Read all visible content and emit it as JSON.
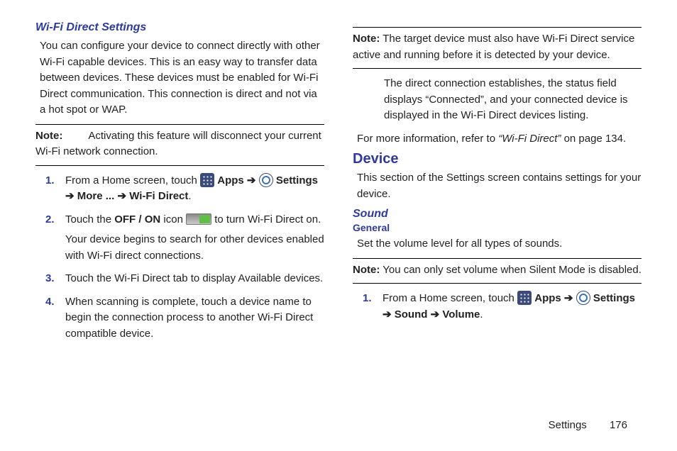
{
  "left": {
    "heading": "Wi-Fi Direct Settings",
    "intro": "You can configure your device to connect directly with other Wi-Fi capable devices. This is an easy way to transfer data between devices. These devices must be enabled for Wi-Fi Direct communication. This connection is direct and not via a hot spot or WAP.",
    "note_label": "Note:",
    "note_text": "Activating this feature will disconnect your current Wi-Fi network connection.",
    "steps": {
      "s1a": "From a Home screen, touch ",
      "s1_apps": " Apps ",
      "s1_arrow": "➔",
      "s1_settings": " Settings ",
      "s1_more": " More ... ",
      "s1_wifi": " Wi-Fi Direct",
      "s1_dot": ".",
      "s2a": "Touch the ",
      "s2_off": "OFF / ON",
      "s2b": " icon ",
      "s2c": " to turn Wi-Fi Direct on.",
      "s2_sub": "Your device begins to search for other devices enabled with Wi-Fi direct connections.",
      "s3": "Touch the Wi-Fi Direct tab to display Available devices.",
      "s4": "When scanning is complete, touch a device name to begin the connection process to another Wi-Fi Direct compatible device."
    },
    "nums": {
      "n1": "1.",
      "n2": "2.",
      "n3": "3.",
      "n4": "4."
    }
  },
  "right": {
    "note_label": "Note:",
    "note_text": "The target device must also have Wi-Fi Direct service active and running before it is detected by your device.",
    "conn_text": "The direct connection establishes, the status field displays “Connected”, and your connected device is displayed in the Wi-Fi Direct devices listing.",
    "ref_a": "For more information, refer to ",
    "ref_i": "“Wi-Fi Direct” ",
    "ref_b": " on page 134.",
    "device_h": "Device",
    "device_p": "This section of the Settings screen contains settings for your device.",
    "sound_h": "Sound",
    "general_h": "General",
    "general_p": "Set the volume level for all types of sounds.",
    "note2_label": "Note:",
    "note2_text": "You can only set volume when Silent Mode is disabled.",
    "step1a": "From a Home screen, touch ",
    "step1_apps": " Apps ",
    "step1_arrow": "➔",
    "step1_settings": " Settings ",
    "step1_sound": " Sound ",
    "step1_volume": " Volume",
    "step1_dot": ".",
    "n1": "1."
  },
  "footer": {
    "section": "Settings",
    "page": "176"
  }
}
